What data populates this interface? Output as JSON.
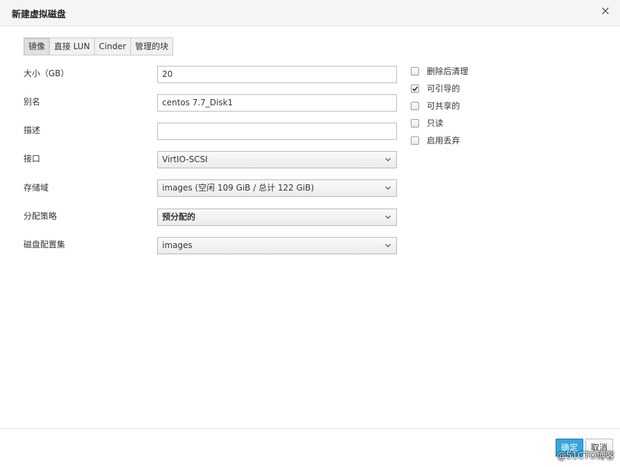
{
  "dialog": {
    "title": "新建虚拟磁盘",
    "close_icon": "×"
  },
  "tabs": [
    {
      "label": "镜像",
      "active": true
    },
    {
      "label": "直接 LUN",
      "active": false
    },
    {
      "label": "Cinder",
      "active": false
    },
    {
      "label": "管理的块",
      "active": false
    }
  ],
  "form": {
    "size": {
      "label": "大小（GB）",
      "value": "20"
    },
    "alias": {
      "label": "别名",
      "value": "centos 7.7_Disk1"
    },
    "description": {
      "label": "描述",
      "value": ""
    },
    "interface": {
      "label": "接口",
      "value": "VirtIO-SCSI"
    },
    "storage_domain": {
      "label": "存储域",
      "value": "images (空闲 109 GiB / 总计 122 GiB)"
    },
    "allocation_policy": {
      "label": "分配策略",
      "value": "预分配的"
    },
    "disk_profile": {
      "label": "磁盘配置集",
      "value": "images"
    }
  },
  "options": [
    {
      "label": "删除后清理",
      "checked": false
    },
    {
      "label": "可引导的",
      "checked": true
    },
    {
      "label": "可共享的",
      "checked": false
    },
    {
      "label": "只读",
      "checked": false
    },
    {
      "label": "启用丢弃",
      "checked": false
    }
  ],
  "footer": {
    "ok_label": "确定",
    "cancel_label": "取消"
  },
  "watermark": "@51CTO博客",
  "colors": {
    "primary": "#39a5dc",
    "header_bg": "#f5f5f5"
  }
}
